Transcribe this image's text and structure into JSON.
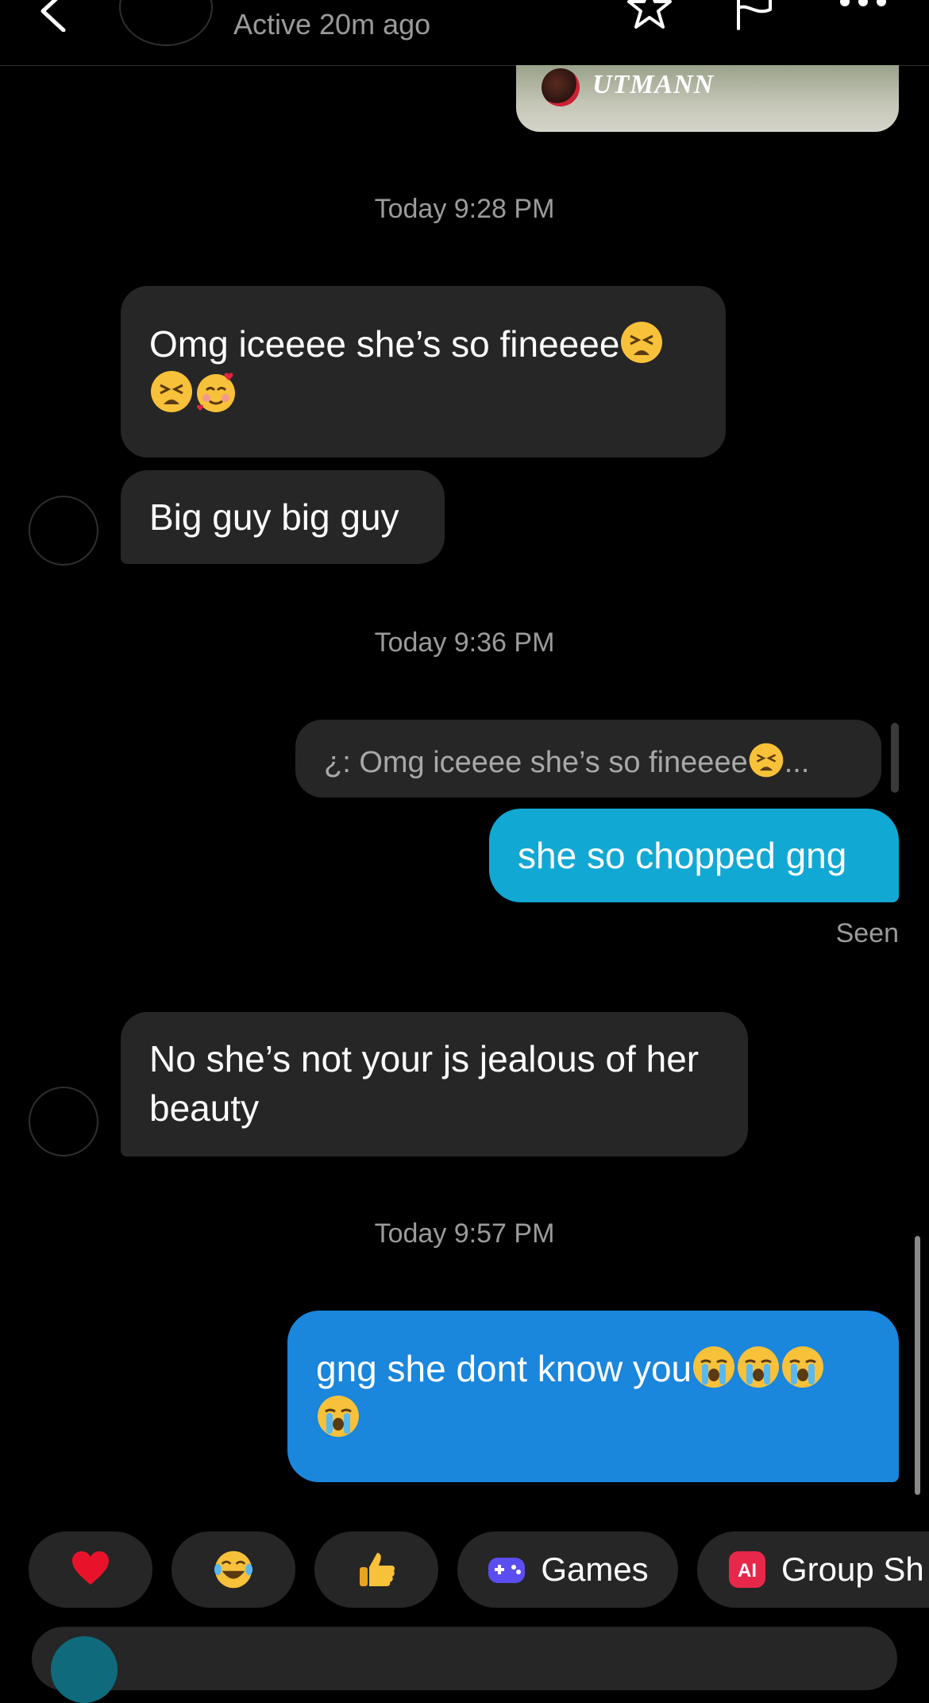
{
  "header": {
    "status": "Active 20m ago"
  },
  "shared_card": {
    "name": "UTMANN"
  },
  "thread": {
    "ts1": "Today 9:28 PM",
    "msg1": "Omg iceeee she’s so fineeee",
    "msg2": "Big guy big guy",
    "ts2": "Today 9:36 PM",
    "reply_preview": "¿: Omg iceeee she’s so fineeee",
    "reply_ellipsis": "...",
    "msg3": "she so chopped gng",
    "seen": "Seen",
    "msg4": "No she’s not your js jealous of her beauty",
    "ts3": "Today 9:57 PM",
    "msg5": "gng she dont know you"
  },
  "quick_actions": {
    "games": "Games",
    "group": "Group Sh"
  },
  "colors": {
    "outgoing_cyan": "#12a8d4",
    "outgoing_blue": "#1a86dc",
    "incoming": "#262626"
  },
  "icons": [
    "back-icon",
    "star-icon",
    "flag-icon",
    "more-icon",
    "heart-icon",
    "laughing-emoji-icon",
    "thumbs-up-icon",
    "gamepad-icon",
    "ai-icon"
  ]
}
